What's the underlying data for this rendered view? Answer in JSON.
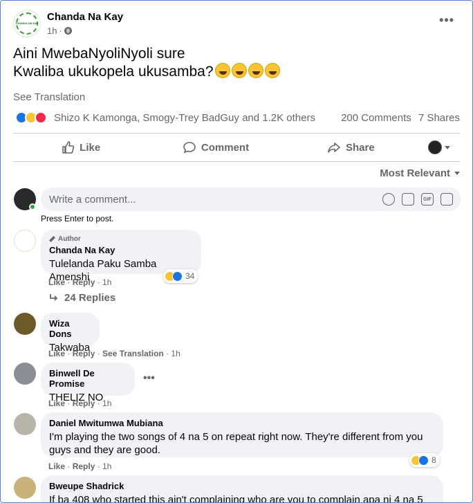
{
  "post": {
    "author": "Chanda Na Kay",
    "logo_text": "CHANDA NA KAY",
    "time": "1h",
    "separator": "·",
    "more": "•••",
    "line1": "Aini MwebaNyoliNyoli sure",
    "line2": "Kwaliba ukukopela ukusamba?",
    "see_translation": "See Translation",
    "reaction_names": "Shizo K Kamonga, Smogy-Trey BadGuy and 1.2K others",
    "comments_count": "200 Comments",
    "shares_count": "7 Shares"
  },
  "actions": {
    "like": "Like",
    "comment": "Comment",
    "share": "Share"
  },
  "sort_label": "Most Relevant",
  "write": {
    "placeholder": "Write a comment...",
    "press_enter": "Press Enter to post.",
    "gif": "GIF"
  },
  "comments": [
    {
      "badge": "Author",
      "name": "Chanda Na Kay",
      "text": "Tulelanda Paku Samba Amenshi",
      "like": "Like",
      "reply": "Reply",
      "time": "1h",
      "reactions": "34",
      "replies": "24 Replies"
    },
    {
      "name": "Wiza Dons",
      "text": "Takwaba",
      "like": "Like",
      "reply": "Reply",
      "see_translation": "See Translation",
      "time": "1h"
    },
    {
      "name": "Binwell De Promise",
      "text": "THELIZ NO",
      "like": "Like",
      "reply": "Reply",
      "time": "1h",
      "more": "•••"
    },
    {
      "name": "Daniel Mwitumwa Mubiana",
      "text_line1": "I'm playing the two songs of 4 na 5 on repeat right now. They're different from you",
      "text_line2": "guys and they are good.",
      "like": "Like",
      "reply": "Reply",
      "time": "1h",
      "reactions": "8"
    },
    {
      "name": "Bweupe Shadrick",
      "text": "If ba 408 who started this ain't complaining who are you to complain apa ni 4 na 5"
    }
  ],
  "colors": {
    "accent": "#1b74e4",
    "secondary_text": "#65676b",
    "bubble": "#f0f2f5"
  }
}
